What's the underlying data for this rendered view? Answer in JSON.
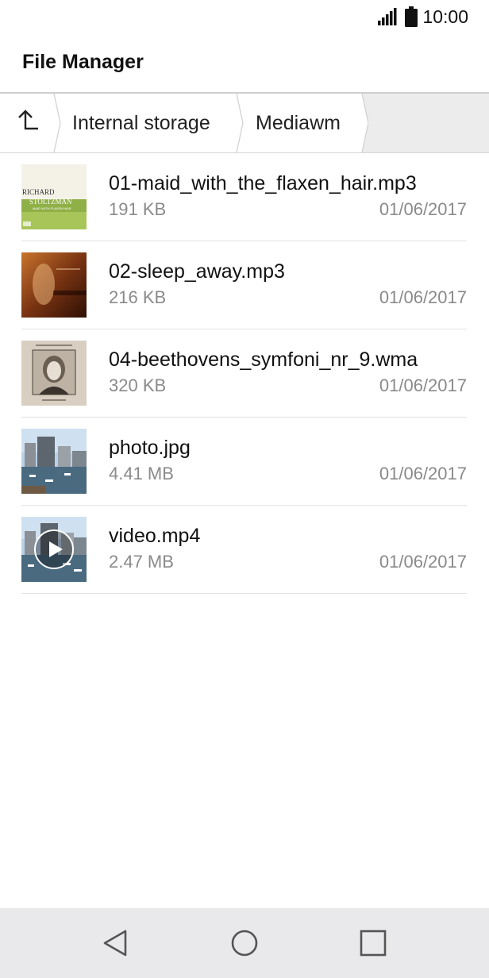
{
  "status_bar": {
    "time": "10:00",
    "icons": [
      "signal-icon",
      "battery-icon"
    ]
  },
  "app_bar": {
    "title": "File Manager"
  },
  "breadcrumb": {
    "up_icon": "up-arrow-icon",
    "items": [
      "Internal storage",
      "Mediawm"
    ]
  },
  "files": [
    {
      "name": "01-maid_with_the_flaxen_hair.mp3",
      "size": "191 KB",
      "date": "01/06/2017",
      "thumb": "album-art-thumbnail"
    },
    {
      "name": "02-sleep_away.mp3",
      "size": "216 KB",
      "date": "01/06/2017",
      "thumb": "album-art-thumbnail"
    },
    {
      "name": "04-beethovens_symfoni_nr_9.wma",
      "size": "320 KB",
      "date": "01/06/2017",
      "thumb": "album-art-thumbnail"
    },
    {
      "name": "photo.jpg",
      "size": "4.41 MB",
      "date": "01/06/2017",
      "thumb": "photo-thumbnail"
    },
    {
      "name": "video.mp4",
      "size": "2.47 MB",
      "date": "01/06/2017",
      "thumb": "video-thumbnail"
    }
  ],
  "thumb_text": {
    "artist_first": "RICHARD",
    "artist_last": "STOLTZMAN",
    "album": "MAID WITH FLAXEN HAIR"
  },
  "nav_bar": {
    "icons": [
      "back-icon",
      "home-icon",
      "recent-apps-icon"
    ]
  }
}
